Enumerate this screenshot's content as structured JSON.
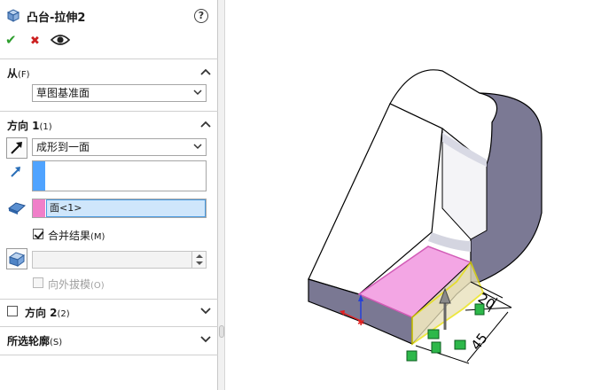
{
  "feature": {
    "title": "凸台-拉伸2",
    "help_label": "?"
  },
  "actions": {
    "ok_label": "✔",
    "cancel_label": "✖"
  },
  "from_section": {
    "title": "从",
    "hotkey": "(F)",
    "value": "草图基准面"
  },
  "direction1": {
    "title": "方向 1",
    "hotkey": "(1)",
    "end_condition": "成形到一面",
    "face_item": "面<1>",
    "merge_label": "合并结果",
    "merge_hotkey": "(M)",
    "merge_checked": true,
    "draft_label": "向外拔模",
    "draft_hotkey": "(O)",
    "draft_checked": false
  },
  "direction2": {
    "title": "方向 2",
    "hotkey": "(2)",
    "checked": false
  },
  "selected_contours": {
    "title": "所选轮廓",
    "hotkey": "(S)"
  },
  "viewport": {
    "dim_top": "20",
    "dim_right": "45"
  },
  "colors": {
    "face_highlight": "#f3a6e4",
    "selection_blue": "#4fa3ff",
    "side_shade": "#7b7994",
    "handle_green": "#2db84a"
  }
}
